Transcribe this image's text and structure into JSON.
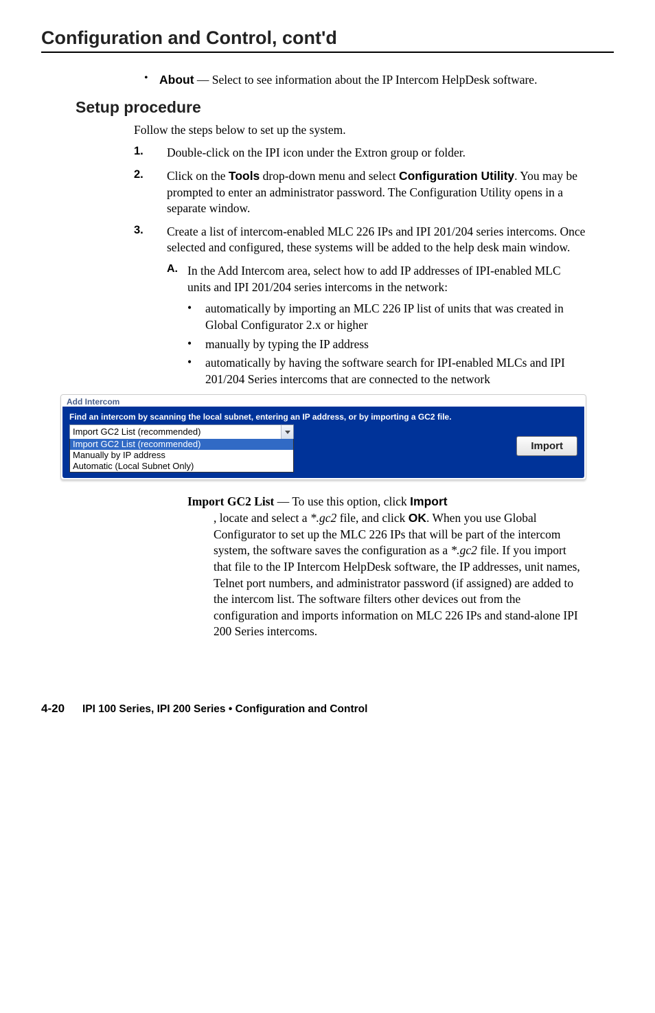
{
  "header": "Configuration and Control, cont'd",
  "top_bullet": {
    "label": "About",
    "text": " —  Select to see information about the IP Intercom HelpDesk software."
  },
  "section_heading": "Setup procedure",
  "intro": "Follow the steps below to set up the system.",
  "step1": {
    "num": "1.",
    "text": "Double-click on the IPI icon under the Extron group or folder."
  },
  "step2": {
    "num": "2.",
    "pre": "Click on the ",
    "bold1": "Tools",
    "mid": " drop-down menu and select ",
    "bold2": "Configuration Utility",
    "post": ".  You may be prompted to enter an administrator password.  The Configuration Utility opens in a separate window."
  },
  "step3": {
    "num": "3.",
    "text": "Create a list of intercom-enabled MLC 226 IPs and IPI 201/204 series intercoms.  Once selected and configured, these systems will be added to the  help desk main window."
  },
  "step3a": {
    "letter": "A.",
    "text": "In the Add Intercom area, select how to add IP addresses of IPI-enabled MLC units and IPI 201/204 series intercoms in the network:"
  },
  "sub_bullets": [
    "automatically by importing an MLC 226 IP list of units that was created in Global Configurator 2.x or higher",
    "manually by typing the IP address",
    "automatically by having the software search for IPI-enabled MLCs and IPI 201/204 Series intercoms that are connected to the network"
  ],
  "screenshot": {
    "group_label": "Add Intercom",
    "prompt": "Find an intercom by scanning the local subnet, entering an IP address, or by importing a GC2 file.",
    "selected": "Import GC2 List (recommended)",
    "options": [
      "Import GC2 List (recommended)",
      "Manually by IP address",
      "Automatic (Local Subnet Only)"
    ],
    "button": "Import"
  },
  "def": {
    "term": "Import GC2 List",
    "dash": " — To use this option, click ",
    "action1": "Import",
    "mid1": ", locate and select a ",
    "file": "*.gc2",
    "mid2": " file, and click ",
    "action2": "OK",
    "body": ".  When you use Global Configurator to set up the MLC 226 IPs that will be part of the intercom system, the software saves the configuration as a ",
    "file2": "*.gc2",
    "body2": " file.  If you import that file to the IP Intercom HelpDesk software, the IP addresses, unit names, Telnet port numbers, and administrator password (if assigned) are added to the intercom list.  The software filters other devices out from the configuration and imports information on MLC 226 IPs and stand-alone IPI 200 Series intercoms."
  },
  "footer": {
    "page": "4-20",
    "text": "IPI 100 Series, IPI 200 Series • Configuration and Control"
  }
}
